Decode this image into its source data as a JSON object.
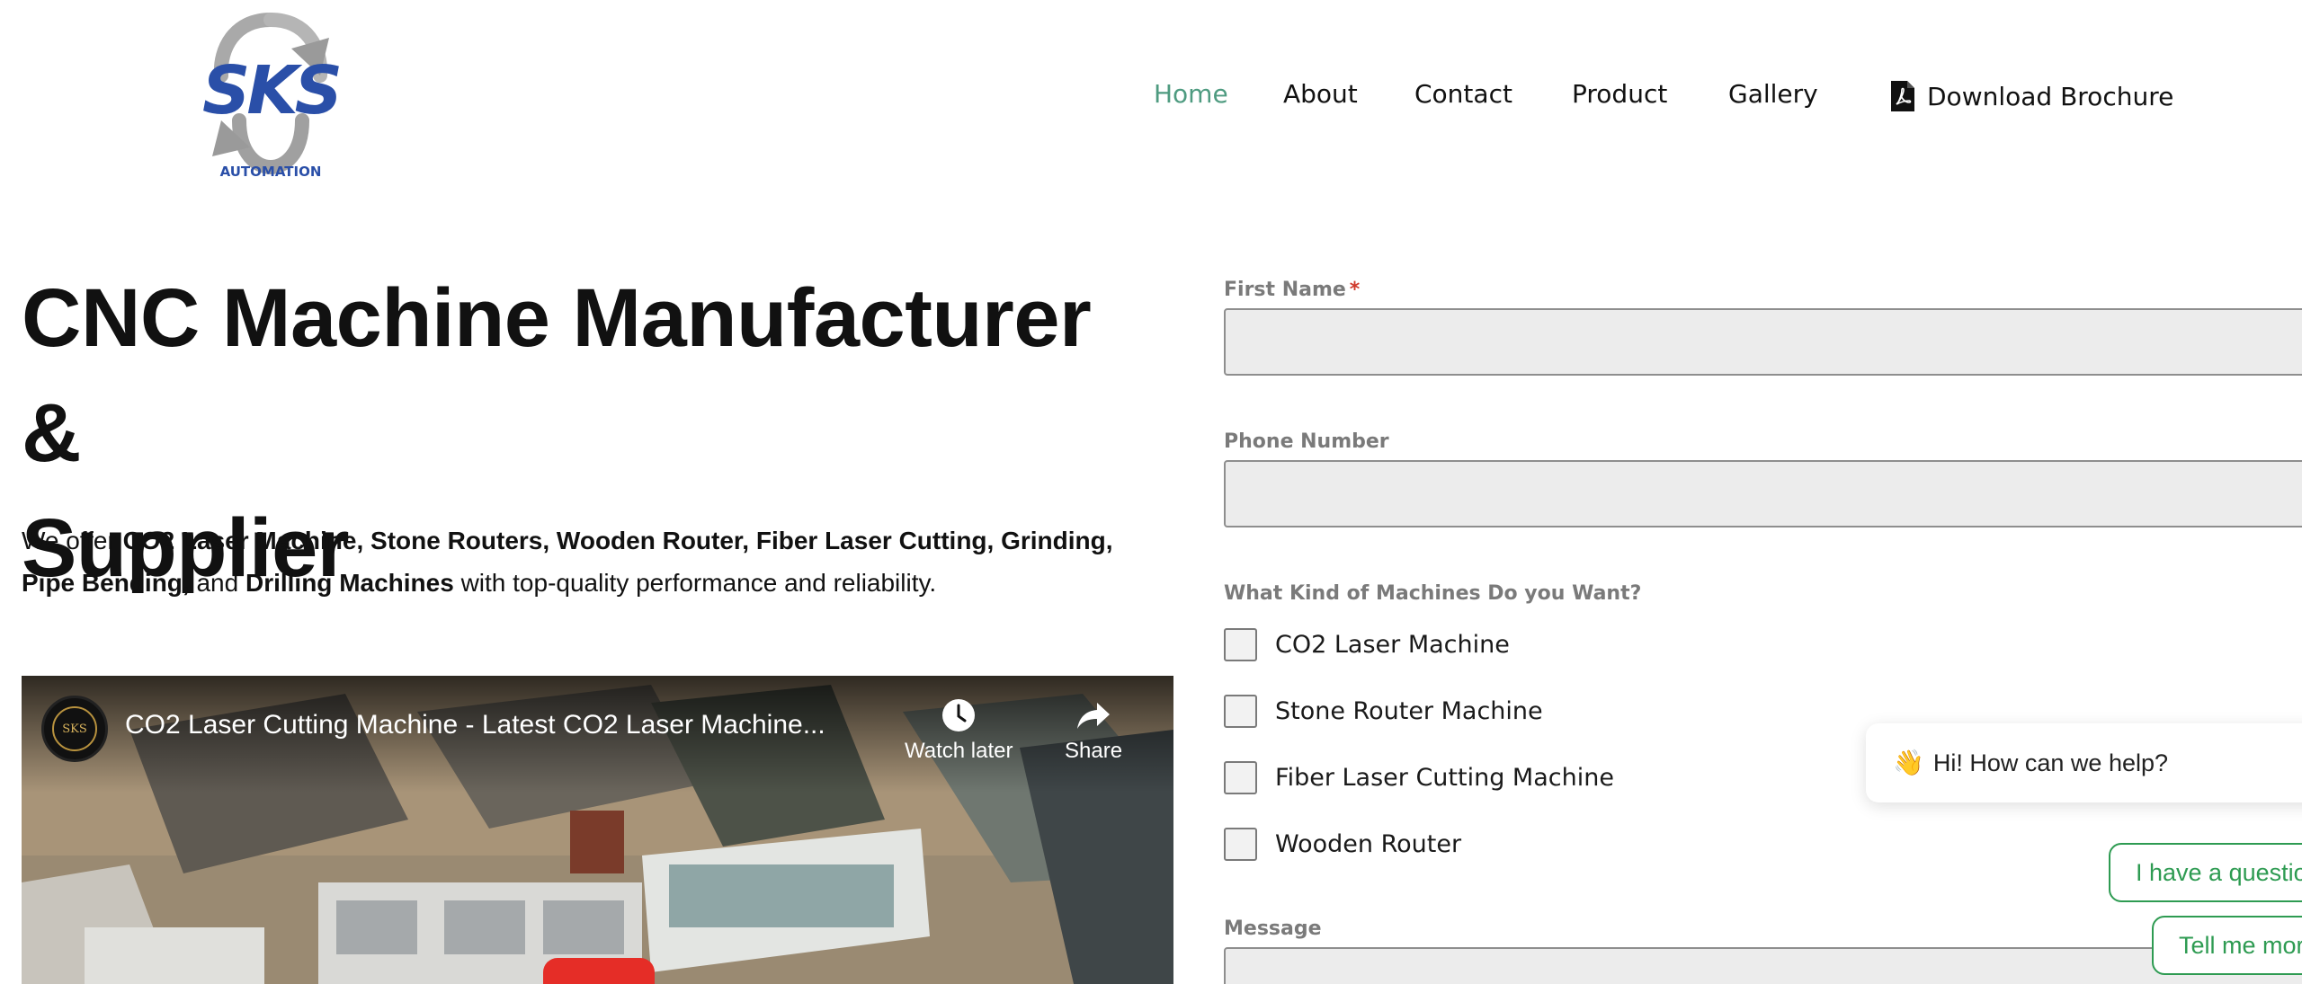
{
  "logo": {
    "alt": "SKS",
    "tagline": "AUTOMATION",
    "colors": {
      "blue": "#2a4fa8",
      "silver": "#a9a9a9"
    }
  },
  "nav": {
    "items": [
      {
        "label": "Home",
        "active": true
      },
      {
        "label": "About"
      },
      {
        "label": "Contact"
      },
      {
        "label": "Product"
      },
      {
        "label": "Gallery"
      }
    ],
    "brochure_label": "Download Brochure",
    "brochure_icon": "pdf-file-icon",
    "active_color": "#4e9b80"
  },
  "hero": {
    "title_line1": "CNC Machine Manufacturer &",
    "title_line2": "Supplier",
    "desc": {
      "prefix": "We offer ",
      "machines": "CO2 Laser Machine, Stone Routers, Wooden Router, Fiber Laser Cutting, Grinding, Pipe Bending,",
      "and": " and ",
      "drilling": "Drilling Machines",
      "suffix": " with top-quality performance and reliability."
    }
  },
  "video": {
    "channel_avatar_text": "SKS",
    "title": "CO2 Laser Cutting Machine - Latest CO2 Laser Machine...",
    "watch_later": "Watch later",
    "share": "Share",
    "play_color": "#e52d27"
  },
  "form": {
    "first_name_label": "First Name",
    "required_mark": "*",
    "phone_label": "Phone Number",
    "kind_label": "What Kind of Machines Do you Want?",
    "options": [
      "CO2 Laser Machine",
      "Stone Router Machine",
      "Fiber Laser Cutting Machine",
      "Wooden Router"
    ],
    "message_label": "Message"
  },
  "chat": {
    "greeting_icon": "waving-hand-icon",
    "greeting": "Hi! How can we help?",
    "option1": "I have a question",
    "option2": "Tell me more",
    "accent": "#2e9b52"
  }
}
